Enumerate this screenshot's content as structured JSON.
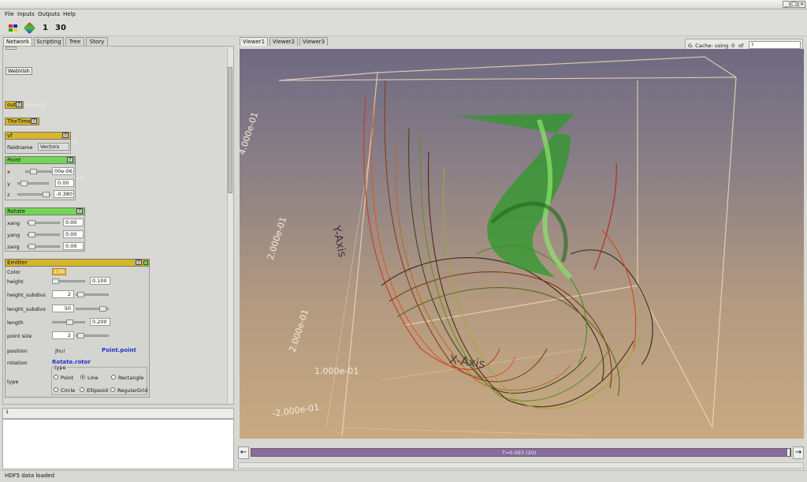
{
  "window": {
    "minimize": "_",
    "maximize": "□",
    "close": "×"
  },
  "menu": [
    "File",
    "Inputs",
    "Outputs",
    "Help"
  ],
  "toolbar": {
    "value1": "1",
    "value2": "30"
  },
  "left_tabs": [
    "Network",
    "Scripting",
    "Tree",
    "Story"
  ],
  "viewer_tabs": [
    "Viewer1",
    "Viewer2",
    "Viewer3"
  ],
  "network": {
    "webvis": "WebVish",
    "out": {
      "label": "out",
      "help": "?",
      "trailing": "Velocity"
    },
    "thetime": {
      "label": "TheTime",
      "help": "?"
    },
    "vf": {
      "label": "vf",
      "help": "?",
      "fieldname_label": "fieldname",
      "fieldname_value": "Vectors",
      "suffix": "ty"
    },
    "point": {
      "label": "Point",
      "help": "?",
      "x_label": "x",
      "x_value": "00e-06",
      "y_label": "y",
      "y_value": "0.00",
      "z_label": "z",
      "z_value": "-0.380",
      "suffix": "cy"
    },
    "rotate": {
      "label": "Rotate",
      "help": "?",
      "xang_label": "xang",
      "xang_value": "0.00",
      "yang_label": "yang",
      "yang_value": "0.00",
      "zang_label": "zang",
      "zang_value": "0.00"
    },
    "emitter": {
      "label": "Emitter",
      "help": "?",
      "color_label": "Color",
      "color_value": "1.00",
      "height_label": "height",
      "height_value": "0.100",
      "height_subdivs_label": "height_subdivs",
      "height_subdivs_value": "2",
      "lenght_subdivs_label": "lenght_subdivs",
      "lenght_subdivs_value": "50",
      "length_label": "length",
      "length_value": "0.200",
      "point_size_label": "point size",
      "point_size_value": "2",
      "position_label": "position",
      "position_mid": "jhu!",
      "position_value": "Point.point",
      "rotation_label": "rotation",
      "rotation_value": "Rotate.rotor",
      "type_label": "type",
      "type_group": "type",
      "type_options": [
        "Point",
        "Line",
        "Rectangle",
        "Circle",
        "Ellipsoid",
        "RegularGrid"
      ],
      "type_selected": "Line"
    }
  },
  "console": {
    "line": "1"
  },
  "status": "HDF5 data loaded",
  "gcache": {
    "label": "G. Cache: using",
    "used": "0",
    "of": "of",
    "value": "?"
  },
  "time": {
    "label": "T=0.093 (20)",
    "prev_icon": "arrow-left-icon",
    "next_icon": "arrow-right-icon"
  },
  "axes": {
    "x": "X-Axis",
    "y": "Y-Axis",
    "z_ticks": [
      "4.000e-01",
      "2.000e-01",
      "2.000e-01",
      "1.000e-01",
      "-2.000e-01"
    ]
  },
  "colors": {
    "accent_yellow": "#d6b62a",
    "accent_green": "#72d652",
    "link": "#2233cc",
    "timebar": "#8a6aa0"
  }
}
